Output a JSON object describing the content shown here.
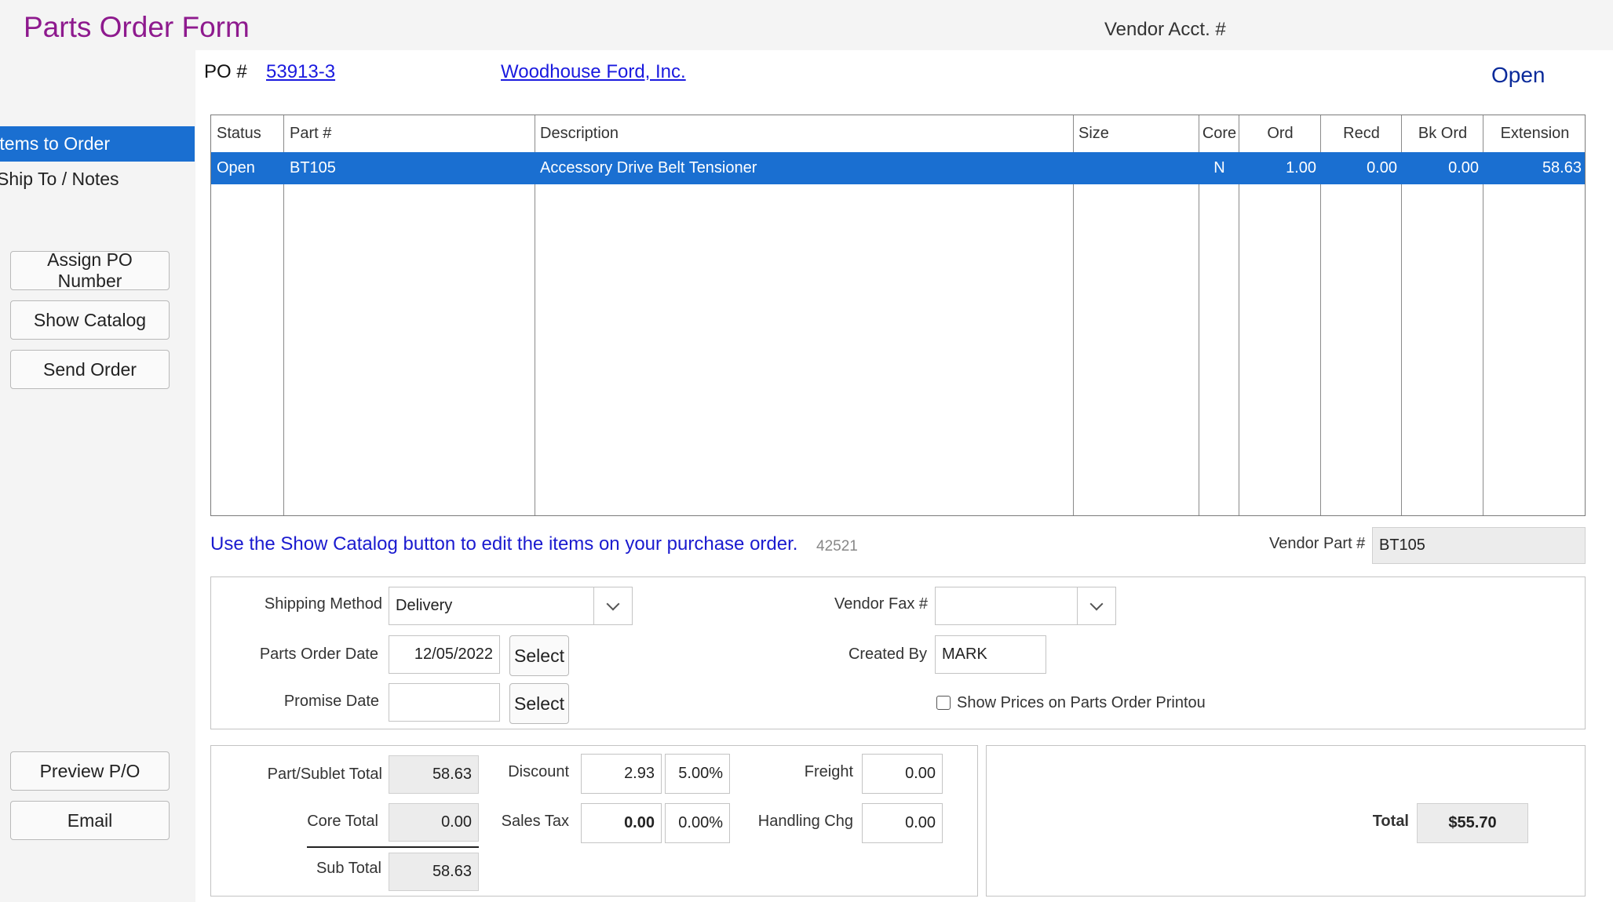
{
  "header": {
    "title": "Parts Order Form",
    "vendor_acct_label": "Vendor Acct. #",
    "status": "Open"
  },
  "sidebar": {
    "tabs": [
      {
        "label": "Items to Order",
        "active": true
      },
      {
        "label": "Ship To / Notes",
        "active": false
      }
    ],
    "buttons": {
      "assign_po": "Assign PO Number",
      "show_catalog": "Show Catalog",
      "send_order": "Send Order",
      "preview_po": "Preview P/O",
      "email": "Email"
    }
  },
  "po": {
    "label": "PO #",
    "number": "53913-3",
    "vendor_name": "Woodhouse Ford, Inc."
  },
  "grid": {
    "headers": {
      "status": "Status",
      "part": "Part #",
      "description": "Description",
      "size": "Size",
      "core": "Core",
      "ord": "Ord",
      "recd": "Recd",
      "bkord": "Bk Ord",
      "extension": "Extension"
    },
    "rows": [
      {
        "status": "Open",
        "part": "BT105",
        "description": "Accessory Drive Belt Tensioner",
        "size": "",
        "core": "N",
        "ord": "1.00",
        "recd": "0.00",
        "bkord": "0.00",
        "extension": "58.63"
      }
    ]
  },
  "info": {
    "message": "Use the Show Catalog button to edit the items on your purchase order.",
    "number": "42521",
    "vendor_part_label": "Vendor Part #",
    "vendor_part_value": "BT105"
  },
  "shipping": {
    "method_label": "Shipping Method",
    "method_value": "Delivery",
    "order_date_label": "Parts Order Date",
    "order_date_value": "12/05/2022",
    "promise_date_label": "Promise Date",
    "promise_date_value": "",
    "select_label": "Select",
    "vendor_fax_label": "Vendor Fax #",
    "vendor_fax_value": "",
    "created_by_label": "Created By",
    "created_by_value": "MARK",
    "show_prices_label": "Show Prices on Parts Order Printou",
    "show_prices_checked": false
  },
  "totals": {
    "part_sublet_label": "Part/Sublet Total",
    "part_sublet_value": "58.63",
    "core_total_label": "Core Total",
    "core_total_value": "0.00",
    "sub_total_label": "Sub Total",
    "sub_total_value": "58.63",
    "discount_label": "Discount",
    "discount_value": "2.93",
    "discount_pct": "5.00%",
    "sales_tax_label": "Sales Tax",
    "sales_tax_value": "0.00",
    "sales_tax_pct": "0.00%",
    "freight_label": "Freight",
    "freight_value": "0.00",
    "handling_label": "Handling Chg",
    "handling_value": "0.00",
    "total_label": "Total",
    "total_value": "$55.70"
  },
  "colors": {
    "title": "#8e1a8e",
    "accent_blue": "#1a6fd1",
    "link": "#1a1adf",
    "info_text": "#1a1acf"
  }
}
